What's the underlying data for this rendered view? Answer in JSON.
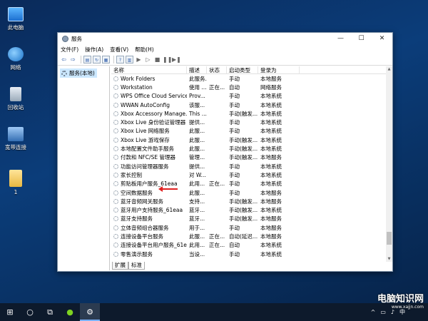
{
  "desktop": {
    "icons": [
      {
        "label": "此电脑"
      },
      {
        "label": "网络"
      },
      {
        "label": "回收站"
      },
      {
        "label": "宽带连接"
      },
      {
        "label": "1"
      }
    ]
  },
  "window": {
    "title": "服务",
    "menu": [
      "文件(F)",
      "操作(A)",
      "查看(V)",
      "帮助(H)"
    ],
    "tree_item": "服务(本地)",
    "columns": [
      "名称",
      "描述",
      "状态",
      "启动类型",
      "登录为"
    ],
    "services": [
      {
        "name": "Work Folders",
        "desc": "此服务...",
        "status": "",
        "startup": "手动",
        "logon": "本地服务"
      },
      {
        "name": "Workstation",
        "desc": "使用 ...",
        "status": "正在...",
        "startup": "自动",
        "logon": "网络服务"
      },
      {
        "name": "WPS Office Cloud Service",
        "desc": "Prov...",
        "status": "",
        "startup": "手动",
        "logon": "本地系统"
      },
      {
        "name": "WWAN AutoConfig",
        "desc": "该服...",
        "status": "",
        "startup": "手动",
        "logon": "本地系统"
      },
      {
        "name": "Xbox Accessory Manage...",
        "desc": "This ...",
        "status": "",
        "startup": "手动(触发...",
        "logon": "本地系统"
      },
      {
        "name": "Xbox Live 身份验证管理器",
        "desc": "提供...",
        "status": "",
        "startup": "手动",
        "logon": "本地系统"
      },
      {
        "name": "Xbox Live 网络服务",
        "desc": "此服...",
        "status": "",
        "startup": "手动",
        "logon": "本地系统"
      },
      {
        "name": "Xbox Live 游戏保存",
        "desc": "此服...",
        "status": "",
        "startup": "手动(触发...",
        "logon": "本地系统"
      },
      {
        "name": "本地配置文件助手服务",
        "desc": "此服...",
        "status": "",
        "startup": "手动(触发...",
        "logon": "本地系统"
      },
      {
        "name": "付款和 NFC/SE 管理器",
        "desc": "管理...",
        "status": "",
        "startup": "手动(触发...",
        "logon": "本地服务"
      },
      {
        "name": "功能访问管理器服务",
        "desc": "提供...",
        "status": "",
        "startup": "手动",
        "logon": "本地系统"
      },
      {
        "name": "家长控制",
        "desc": "对 W...",
        "status": "",
        "startup": "手动",
        "logon": "本地系统"
      },
      {
        "name": "剪贴板用户服务_61eaa",
        "desc": "此用...",
        "status": "正在...",
        "startup": "手动",
        "logon": "本地系统"
      },
      {
        "name": "空间数据服务",
        "desc": "此服...",
        "status": "",
        "startup": "手动",
        "logon": "本地服务"
      },
      {
        "name": "蓝牙音频网关服务",
        "desc": "支持...",
        "status": "",
        "startup": "手动(触发...",
        "logon": "本地服务"
      },
      {
        "name": "蓝牙用户支持服务_61eaa",
        "desc": "蓝牙...",
        "status": "",
        "startup": "手动(触发...",
        "logon": "本地系统"
      },
      {
        "name": "蓝牙支持服务",
        "desc": "蓝牙...",
        "status": "",
        "startup": "手动(触发...",
        "logon": "本地服务"
      },
      {
        "name": "立体音频组合器服务",
        "desc": "用于...",
        "status": "",
        "startup": "手动",
        "logon": "本地服务"
      },
      {
        "name": "连接设备平台服务",
        "desc": "此服...",
        "status": "正在...",
        "startup": "自动(延迟...",
        "logon": "本地服务"
      },
      {
        "name": "连接设备平台用户服务_61e...",
        "desc": "此用...",
        "status": "正在...",
        "startup": "自动",
        "logon": "本地系统"
      },
      {
        "name": "零售演示服务",
        "desc": "当设...",
        "status": "",
        "startup": "手动",
        "logon": "本地系统"
      }
    ],
    "tabs": [
      "扩展",
      "标准"
    ]
  },
  "taskbar": {
    "tray_lang": "中"
  },
  "watermark": {
    "text": "电脑知识网",
    "url": "www.xajjn.com"
  }
}
